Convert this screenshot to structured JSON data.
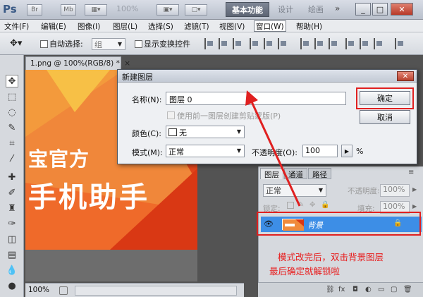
{
  "app": {
    "logo": "Ps",
    "zoom": "100%",
    "workspaces": {
      "basic": "基本功能",
      "design": "设计",
      "paint": "绘画",
      "more": "»"
    },
    "window_buttons": {
      "minimize": "_",
      "restore": "□",
      "close": "✕"
    }
  },
  "menubar": {
    "items": [
      "文件(F)",
      "编辑(E)",
      "图像(I)",
      "图层(L)",
      "选择(S)",
      "滤镜(T)",
      "视图(V)",
      "窗口(W)",
      "帮助(H)"
    ]
  },
  "options": {
    "auto_select_label": "自动选择:",
    "group_value": "组",
    "show_transform_label": "显示变换控件"
  },
  "document": {
    "tab_title": "1.png @ 100%(RGB/8) *",
    "tab_close": "×",
    "art_line1": "宝官方",
    "art_line2": "手机助手",
    "status_zoom": "100%"
  },
  "dialog": {
    "title": "新建图层",
    "close": "✕",
    "name_label": "名称(N):",
    "name_value": "图层 0",
    "use_prev_label": "使用前一图层创建剪贴蒙版(P)",
    "color_label": "颜色(C):",
    "color_value": "无",
    "mode_label": "模式(M):",
    "mode_value": "正常",
    "opacity_label": "不透明度(O):",
    "opacity_value": "100",
    "opacity_unit": "%",
    "ok_label": "确定",
    "cancel_label": "取消"
  },
  "layers": {
    "tabs": [
      "图层",
      "通道",
      "路径"
    ],
    "blend_mode": "正常",
    "opacity_label": "不透明度:",
    "opacity_value": "100%",
    "lock_label": "锁定:",
    "fill_label": "填充:",
    "fill_value": "100%",
    "layer_name": "背景"
  },
  "annotation": {
    "line1": "模式改完后，双击背景图层",
    "line2": "最后确定就解锁啦",
    "color": "#e81c1c"
  }
}
